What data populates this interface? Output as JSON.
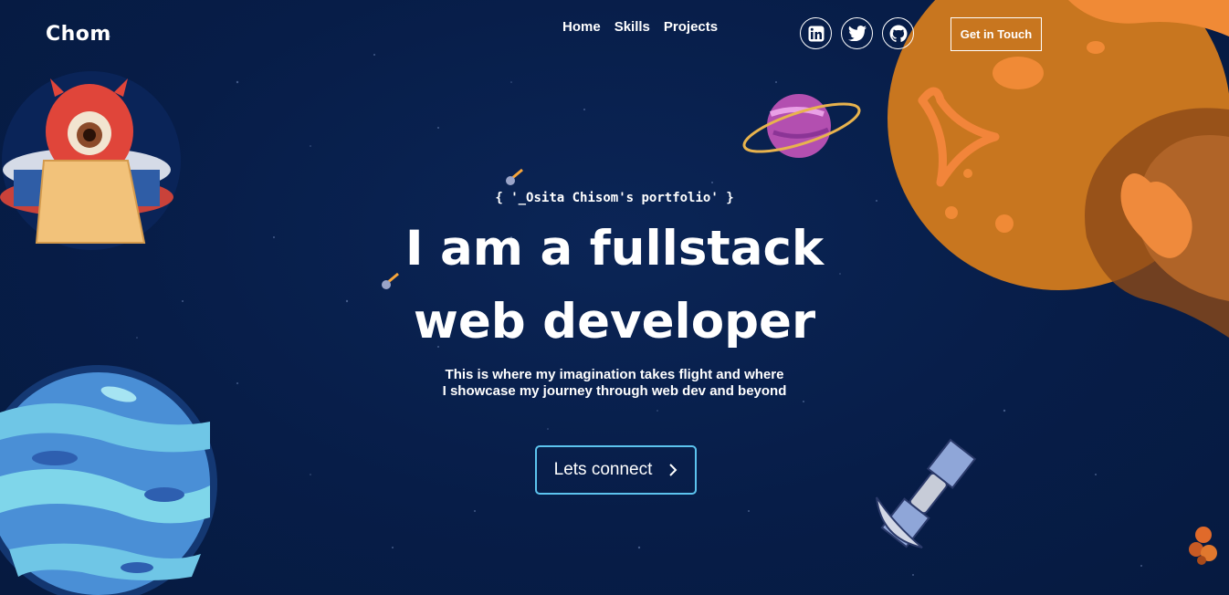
{
  "nav": {
    "brand": "Chom",
    "links": [
      "Home",
      "Skills",
      "Projects"
    ],
    "socials": [
      "linkedin-icon",
      "twitter-icon",
      "github-icon"
    ],
    "cta_label": "Get in Touch"
  },
  "hero": {
    "tagline": "{ '_Osita Chisom's portfolio' }",
    "headline_line1": "I am a fullstack",
    "headline_line2": "web developer",
    "description_line1": "This is where my imagination takes flight and where",
    "description_line2": "I showcase my journey through web dev and beyond",
    "button_label": "Lets connect",
    "button_icon": "chevron-right-icon"
  },
  "colors": {
    "background": "#071d48",
    "accent_border": "#5cc3ee",
    "planet_orange": "#d8822a",
    "planet_blue": "#4a8fd6"
  }
}
